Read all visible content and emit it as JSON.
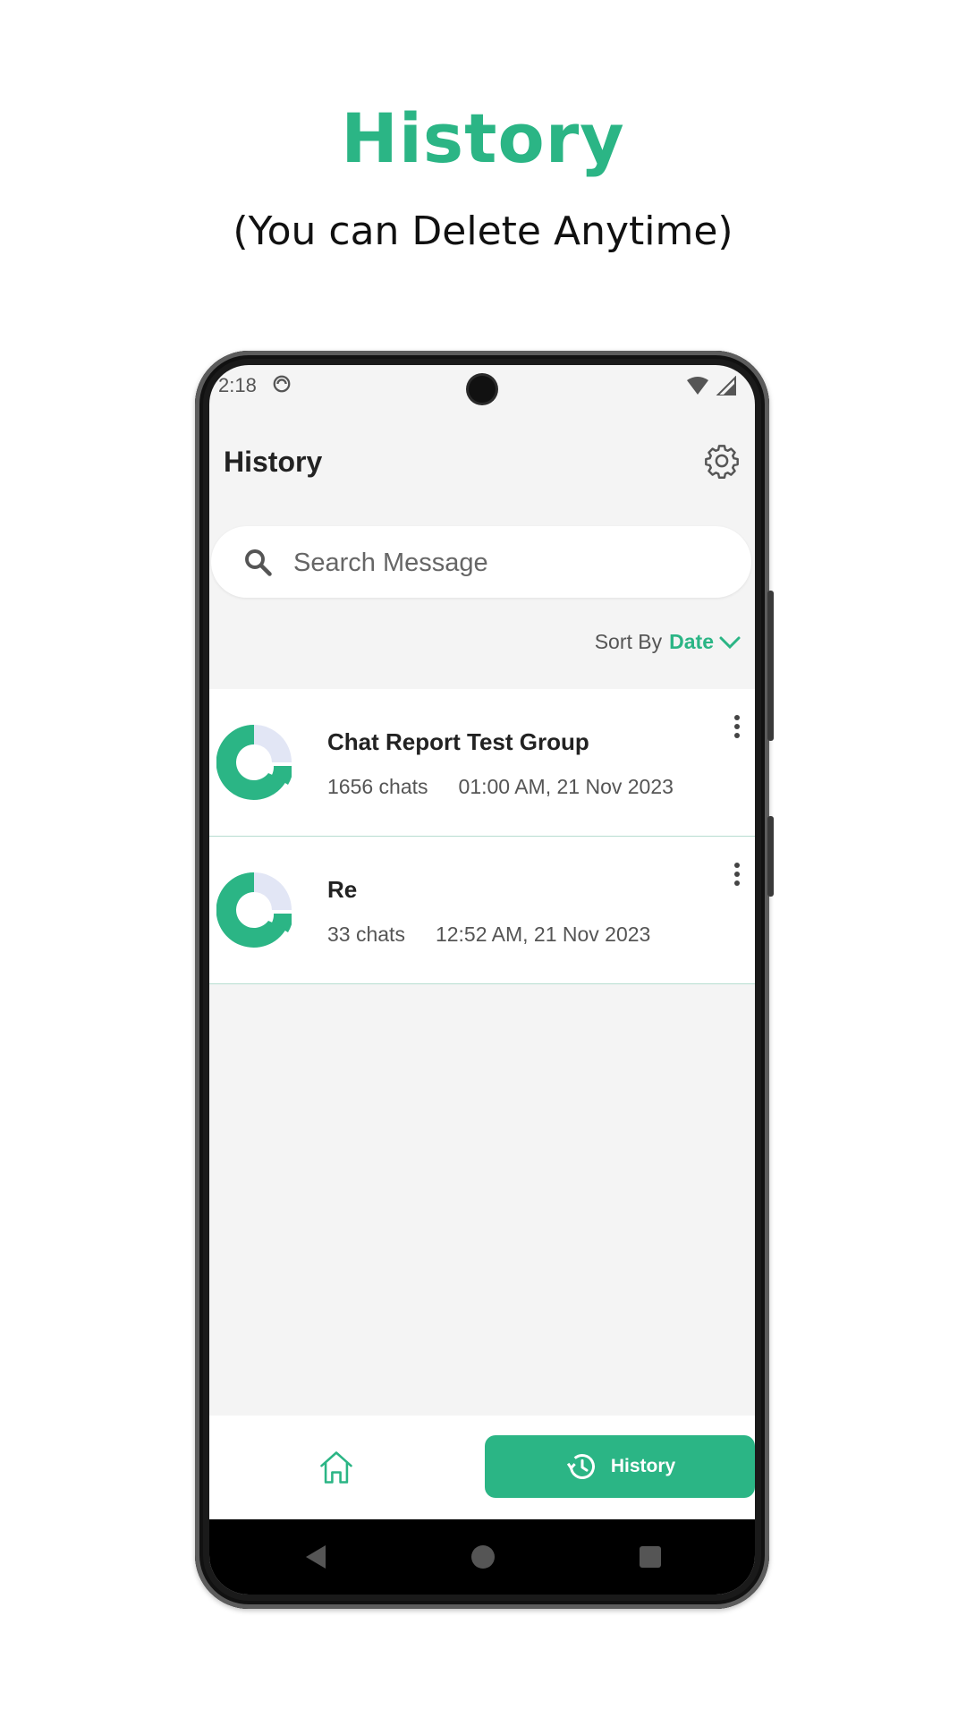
{
  "promo": {
    "title": "History",
    "subtitle": "(You can Delete Anytime)"
  },
  "status_bar": {
    "time": "2:18",
    "icons": [
      "dnd-icon",
      "wifi-icon",
      "signal-icon"
    ]
  },
  "app_bar": {
    "title": "History",
    "settings_icon": "gear-icon"
  },
  "search": {
    "placeholder": "Search Message",
    "value": ""
  },
  "sort": {
    "label": "Sort By",
    "value": "Date"
  },
  "history_items": [
    {
      "title": "Chat Report Test Group",
      "chats": "1656 chats",
      "date": "01:00 AM, 21 Nov 2023"
    },
    {
      "title": "Re",
      "chats": "33 chats",
      "date": "12:52 AM, 21 Nov 2023"
    }
  ],
  "bottom_nav": {
    "home_icon": "home-icon",
    "history_label": "History",
    "history_icon": "history-icon"
  },
  "colors": {
    "accent": "#2bb585",
    "donut_light": "#e2e6f5",
    "background": "#f4f4f4"
  }
}
